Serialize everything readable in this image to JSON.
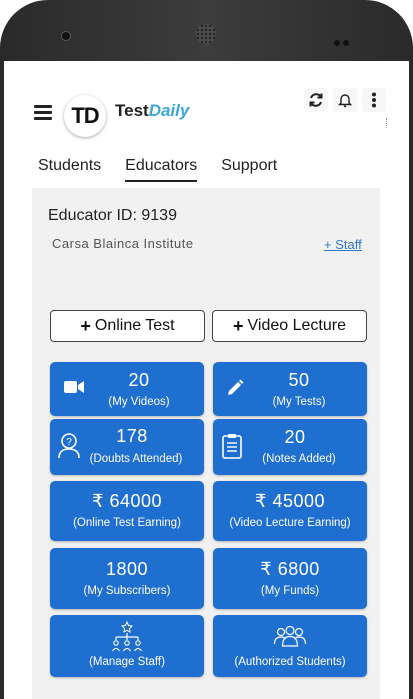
{
  "header": {
    "logo_text": "TD",
    "brand_part1": "Test",
    "brand_part2": "Daily"
  },
  "tabs": [
    {
      "label": "Students"
    },
    {
      "label": "Educators"
    },
    {
      "label": "Support"
    }
  ],
  "educator": {
    "id_label": "Educator ID: 9139",
    "institute": "Carsa Blainca Institute",
    "staff_link": "+ Staff"
  },
  "actions": {
    "online_test": "Online Test",
    "video_lecture": "Video Lecture"
  },
  "cards": [
    {
      "value": "20",
      "label": "(My Videos)",
      "icon": "video-camera-icon"
    },
    {
      "value": "50",
      "label": "(My Tests)",
      "icon": "pencil-icon"
    },
    {
      "value": "178",
      "label": "(Doubts Attended)",
      "icon": "question-person-icon"
    },
    {
      "value": "20",
      "label": "(Notes Added)",
      "icon": "clipboard-icon"
    },
    {
      "value": "₹ 64000",
      "label": "(Online Test Earning)"
    },
    {
      "value": "₹ 45000",
      "label": "(Video Lecture Earning)"
    },
    {
      "value": "1800",
      "label": "(My Subscribers)"
    },
    {
      "value": "₹ 6800",
      "label": "(My Funds)"
    },
    {
      "value": "",
      "label": "(Manage Staff)",
      "icon": "org-chart-icon"
    },
    {
      "value": "",
      "label": "(Authorized Students)",
      "icon": "users-group-icon"
    }
  ],
  "colors": {
    "card_blue": "#1f6fd0",
    "brand_accent": "#3aa9d8",
    "link": "#2f79c6"
  }
}
